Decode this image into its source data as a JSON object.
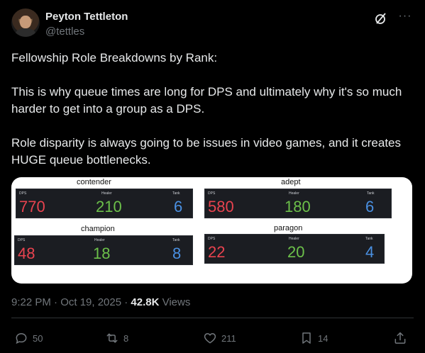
{
  "author": {
    "name": "Peyton Tettleton",
    "handle": "@tettles"
  },
  "header_icons": [
    "grok-icon",
    "more-icon"
  ],
  "tweet": {
    "paragraphs": [
      "Fellowship Role Breakdowns by Rank:",
      "This is why queue times are long for DPS and ultimately why it's so much harder to get into a group as a DPS.",
      "Role disparity is always going to be issues in video games, and it creates HUGE queue bottlenecks."
    ]
  },
  "media": {
    "panels": [
      {
        "title": "contender",
        "dps_label": "DPS",
        "healer_label": "Healer",
        "tank_label": "Tank",
        "dps": "770",
        "healer": "210",
        "tank": "6"
      },
      {
        "title": "adept",
        "dps_label": "DPS",
        "healer_label": "Healer",
        "tank_label": "Tank",
        "dps": "580",
        "healer": "180",
        "tank": "6"
      },
      {
        "title": "champion",
        "dps_label": "DPS",
        "healer_label": "Healer",
        "tank_label": "Tank",
        "dps": "48",
        "healer": "18",
        "tank": "8"
      },
      {
        "title": "paragon",
        "dps_label": "DPS",
        "healer_label": "Healer",
        "tank_label": "Tank",
        "dps": "22",
        "healer": "20",
        "tank": "4"
      }
    ],
    "colors": {
      "dps": "#e8434f",
      "healer": "#6cc04a",
      "tank": "#4a90e2"
    }
  },
  "meta": {
    "time": "9:22 PM · Oct 19, 2025 · ",
    "views_count": "42.8K",
    "views_label": " Views"
  },
  "actions": {
    "replies": "50",
    "reposts": "8",
    "likes": "211",
    "bookmarks": "14"
  }
}
